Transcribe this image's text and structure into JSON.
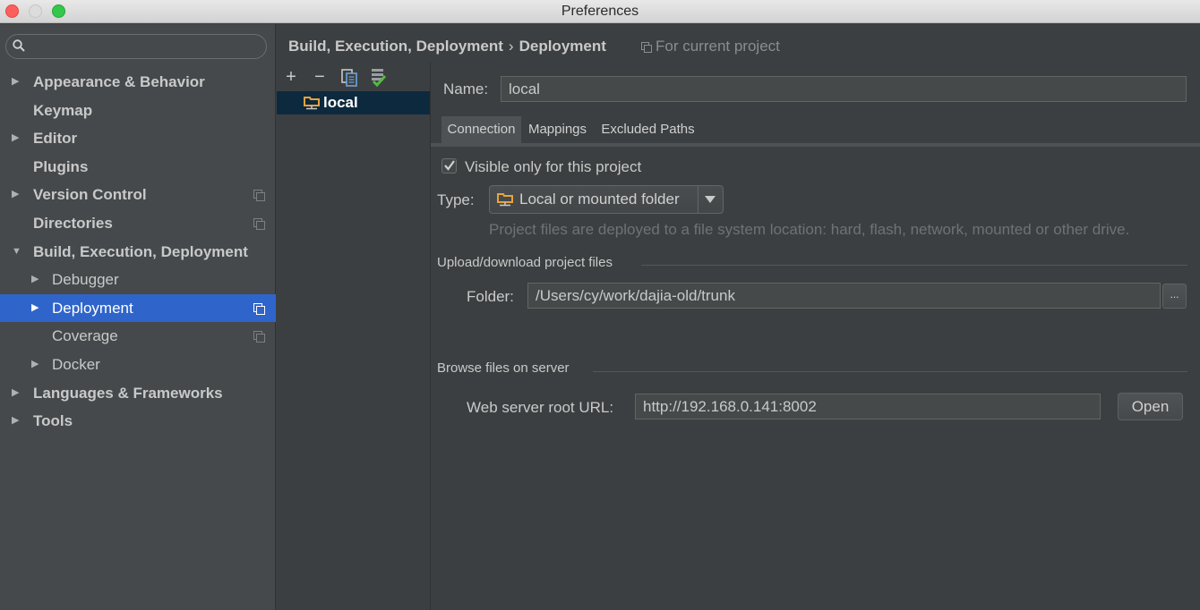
{
  "window": {
    "title": "Preferences"
  },
  "search": {
    "value": "",
    "placeholder": ""
  },
  "sidebar": {
    "items": [
      {
        "label": "Appearance & Behavior",
        "has_arrow": true,
        "arrow": "▶",
        "bold": true,
        "indent": 0
      },
      {
        "label": "Keymap",
        "bold": true
      },
      {
        "label": "Editor",
        "arrow": "▶",
        "bold": true
      },
      {
        "label": "Plugins",
        "bold": true
      },
      {
        "label": "Version Control",
        "arrow": "▶",
        "bold": true,
        "project_icon": true
      },
      {
        "label": "Directories",
        "bold": true,
        "project_icon": true
      },
      {
        "label": "Build, Execution, Deployment",
        "arrow": "▼",
        "bold": true
      },
      {
        "label": "Debugger",
        "arrow": "▶"
      },
      {
        "label": "Deployment",
        "arrow": "▶",
        "selected": true,
        "project_icon": true
      },
      {
        "label": "Coverage",
        "project_icon": true
      },
      {
        "label": "Docker",
        "arrow": "▶"
      },
      {
        "label": "Languages & Frameworks",
        "arrow": "▶",
        "bold": true
      },
      {
        "label": "Tools",
        "arrow": "▶",
        "bold": true
      }
    ]
  },
  "breadcrumb": {
    "parent": "Build, Execution, Deployment",
    "separator": "›",
    "current": "Deployment",
    "scope": "For current project"
  },
  "server_toolbar": {
    "add": "+",
    "remove": "−"
  },
  "servers": [
    {
      "name": "local",
      "selected": true
    }
  ],
  "details": {
    "name_label": "Name:",
    "name_value": "local",
    "tabs": [
      "Connection",
      "Mappings",
      "Excluded Paths"
    ],
    "active_tab": "Connection",
    "visible_only_label": "Visible only for this project",
    "visible_only_checked": true,
    "type_label": "Type:",
    "type_value": "Local or mounted folder",
    "type_hint": "Project files are deployed to a file system location:  hard, flash, network, mounted or other drive.",
    "upload_section": "Upload/download project files",
    "folder_label": "Folder:",
    "folder_value": "/Users/cy/work/dajia-old/trunk",
    "browse_label": "...",
    "browse_section": "Browse files on server",
    "web_root_label": "Web server root URL:",
    "web_root_value": "http://192.168.0.141:8002",
    "open_label": "Open"
  },
  "colors": {
    "selection": "#2f65ca",
    "server_selection": "#0d293e",
    "folder_icon": "#e8a33c"
  }
}
